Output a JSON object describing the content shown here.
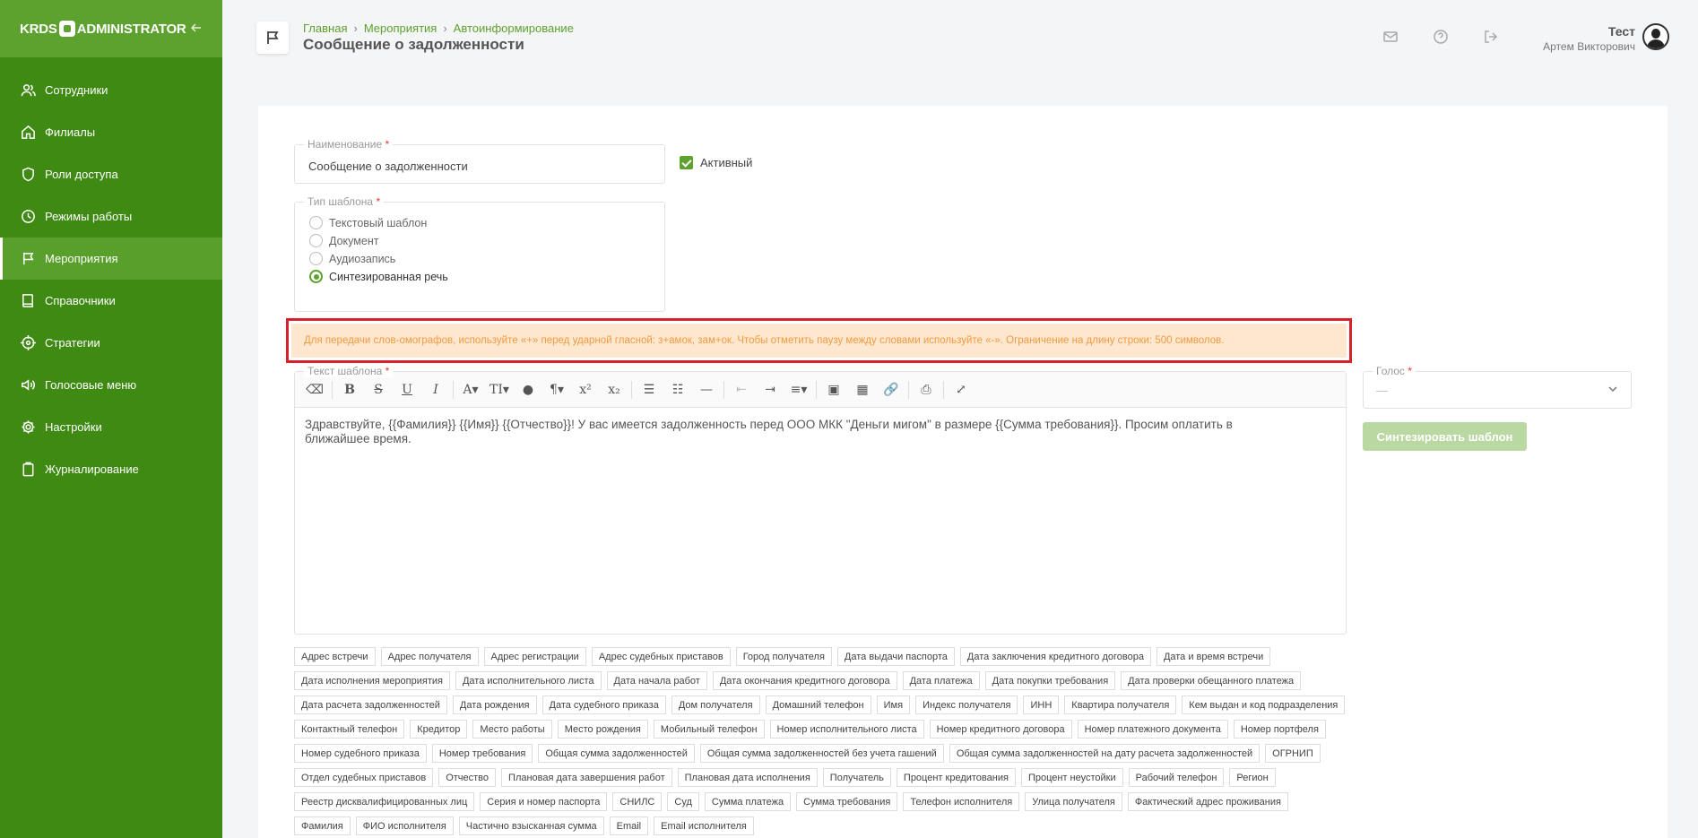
{
  "app": {
    "logo_left": "KRDS",
    "logo_right": "ADMINISTRATOR",
    "collapse_icon": "arrow-left-icon"
  },
  "sidebar": {
    "items": [
      {
        "label": "Сотрудники",
        "icon": "users-icon",
        "active": false
      },
      {
        "label": "Филиалы",
        "icon": "home-icon",
        "active": false
      },
      {
        "label": "Роли доступа",
        "icon": "shield-icon",
        "active": false
      },
      {
        "label": "Режимы работы",
        "icon": "clock-icon",
        "active": false
      },
      {
        "label": "Мероприятия",
        "icon": "flag-icon",
        "active": true
      },
      {
        "label": "Справочники",
        "icon": "book-icon",
        "active": false
      },
      {
        "label": "Стратегии",
        "icon": "target-icon",
        "active": false
      },
      {
        "label": "Голосовые меню",
        "icon": "speaker-icon",
        "active": false
      },
      {
        "label": "Настройки",
        "icon": "gear-icon",
        "active": false
      },
      {
        "label": "Журналирование",
        "icon": "clipboard-icon",
        "active": false
      }
    ]
  },
  "header": {
    "breadcrumbs": [
      "Главная",
      "Мероприятия",
      "Автоинформирование"
    ],
    "breadcrumb_sep": "›",
    "title": "Сообщение о задолженности",
    "user": {
      "name": "Тест",
      "subname": "Артем Викторович"
    }
  },
  "form": {
    "name_label": "Наименование",
    "required_mark": "*",
    "name_value": "Сообщение о задолженности",
    "active_label": "Активный",
    "active_checked": true,
    "type_label": "Тип шаблона",
    "type_options": [
      "Текстовый шаблон",
      "Документ",
      "Аудиозапись",
      "Синтезированная речь"
    ],
    "type_selected": "Синтезированная речь",
    "alert_text": "Для передачи слов-омографов, используйте «+» перед ударной гласной: з+амок, зам+ок. Чтобы отметить паузу между словами используйте «-». Ограничение на длину строки: 500 символов.",
    "template_label": "Текст шаблона",
    "template_text": "Здравствуйте, {{Фамилия}} {{Имя}} {{Отчество}}! У вас имеется задолженность перед ООО МКК \"Деньги мигом\" в размере {{Сумма требования}}. Просим оплатить в ближайшее время.",
    "voice_label": "Голос",
    "voice_value": "—",
    "synth_button": "Синтезировать шаблон",
    "toolbar": {
      "eraser": "⌫",
      "bold": "B",
      "strike": "S",
      "underline": "U",
      "italic": "I",
      "font": "A▾",
      "size": "TI▾",
      "color": "●",
      "paragraph": "¶▾",
      "sup": "x²",
      "sub": "x₂",
      "ul": "☰",
      "ol": "☷",
      "hr": "—",
      "outdent": "⇤",
      "indent": "⇥",
      "align": "≡▾",
      "image": "▣",
      "table": "▦",
      "link": "🔗",
      "print": "⎙",
      "fullscreen": "⤢"
    },
    "tags": [
      "Адрес встречи",
      "Адрес получателя",
      "Адрес регистрации",
      "Адрес судебных приставов",
      "Город получателя",
      "Дата выдачи паспорта",
      "Дата заключения кредитного договора",
      "Дата и время встречи",
      "Дата исполнения мероприятия",
      "Дата исполнительного листа",
      "Дата начала работ",
      "Дата окончания кредитного договора",
      "Дата платежа",
      "Дата покупки требования",
      "Дата проверки обещанного платежа",
      "Дата расчета задолженностей",
      "Дата рождения",
      "Дата судебного приказа",
      "Дом получателя",
      "Домашний телефон",
      "Имя",
      "Индекс получателя",
      "ИНН",
      "Квартира получателя",
      "Кем выдан и код подразделения",
      "Контактный телефон",
      "Кредитор",
      "Место работы",
      "Место рождения",
      "Мобильный телефон",
      "Номер исполнительного листа",
      "Номер кредитного договора",
      "Номер платежного документа",
      "Номер портфеля",
      "Номер судебного приказа",
      "Номер требования",
      "Общая сумма задолженностей",
      "Общая сумма задолженностей без учета гашений",
      "Общая сумма задолженностей на дату расчета задолженностей",
      "ОГРНИП",
      "Отдел судебных приставов",
      "Отчество",
      "Плановая дата завершения работ",
      "Плановая дата исполнения",
      "Получатель",
      "Процент кредитования",
      "Процент неустойки",
      "Рабочий телефон",
      "Регион",
      "Реестр дисквалифицированных лиц",
      "Серия и номер паспорта",
      "СНИЛС",
      "Суд",
      "Сумма платежа",
      "Сумма требования",
      "Телефон исполнителя",
      "Улица получателя",
      "Фактический адрес проживания",
      "Фамилия",
      "ФИО исполнителя",
      "Частично взысканная сумма",
      "Email",
      "Email исполнителя"
    ]
  },
  "colors": {
    "sidebar": "#3e8a13",
    "sidebar_header": "#5da12e",
    "accent": "#5da12e",
    "alert_bg": "#fde7cf",
    "alert_text": "#f29a40",
    "alert_border": "#d9212c"
  }
}
